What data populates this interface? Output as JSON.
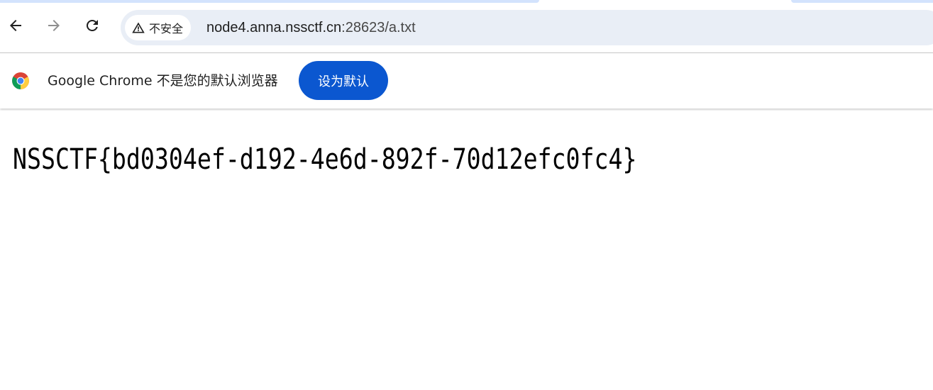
{
  "browser": {
    "nav": {
      "back_icon": "arrow-left-icon",
      "forward_icon": "arrow-right-icon",
      "reload_icon": "reload-icon"
    },
    "omnibox": {
      "security_icon": "warning-triangle-icon",
      "security_label": "不安全",
      "url_host": "node4.anna.nssctf.cn",
      "url_rest": ":28623/a.txt"
    },
    "infobar": {
      "logo_icon": "chrome-logo-icon",
      "message": "Google Chrome 不是您的默认浏览器",
      "button_label": "设为默认"
    },
    "accent_color": "#0b57d0"
  },
  "page": {
    "text": "NSSCTF{bd0304ef-d192-4e6d-892f-70d12efc0fc4}"
  }
}
